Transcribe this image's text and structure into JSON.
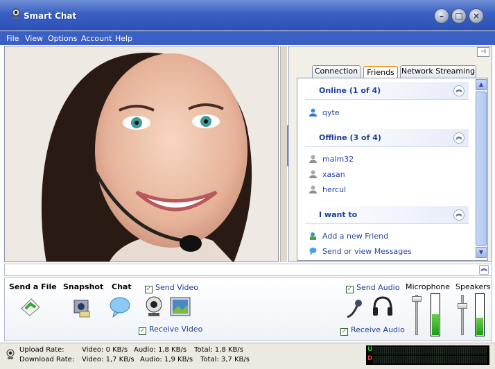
{
  "window": {
    "title": "Smart Chat"
  },
  "menu": [
    "File",
    "View",
    "Options",
    "Account",
    "Help"
  ],
  "tabs": [
    {
      "label": "Connection",
      "active": false
    },
    {
      "label": "Friends",
      "active": true
    },
    {
      "label": "Network Streaming",
      "active": false
    }
  ],
  "groups": {
    "online": {
      "title": "Online (1 of 4)",
      "items": [
        "qyte"
      ]
    },
    "offline": {
      "title": "Offline (3 of 4)",
      "items": [
        "malm32",
        "xasan",
        "hercul"
      ]
    },
    "actions": {
      "title": "I want to",
      "items": [
        "Add a new Friend",
        "Send or view Messages"
      ]
    }
  },
  "controls": {
    "send_file": "Send a File",
    "snapshot": "Snapshot",
    "chat": "Chat",
    "send_video": "Send Video",
    "receive_video": "Receive Video",
    "send_audio": "Send Audio",
    "receive_audio": "Receive Audio",
    "microphone": "Microphone",
    "speakers": "Speakers",
    "microphone_level": 0.5,
    "speakers_level": 0.42
  },
  "status": {
    "upload_label": "Upload Rate:",
    "upload_video": "Video: 0 KB/s",
    "upload_audio": "Audio: 1,8 KB/s",
    "upload_total": "Total: 1,8 KB/s",
    "download_label": "Download Rate:",
    "download_video": "Video: 1,7 KB/s",
    "download_audio": "Audio: 1,9 KB/s",
    "download_total": "Total: 3,7 KB/s",
    "meter_u": "U",
    "meter_d": "D"
  },
  "colors": {
    "titlebar": "#3a60c4",
    "link": "#2346a8",
    "group_title": "#1f3e9a",
    "meter": "#1a9e18"
  }
}
